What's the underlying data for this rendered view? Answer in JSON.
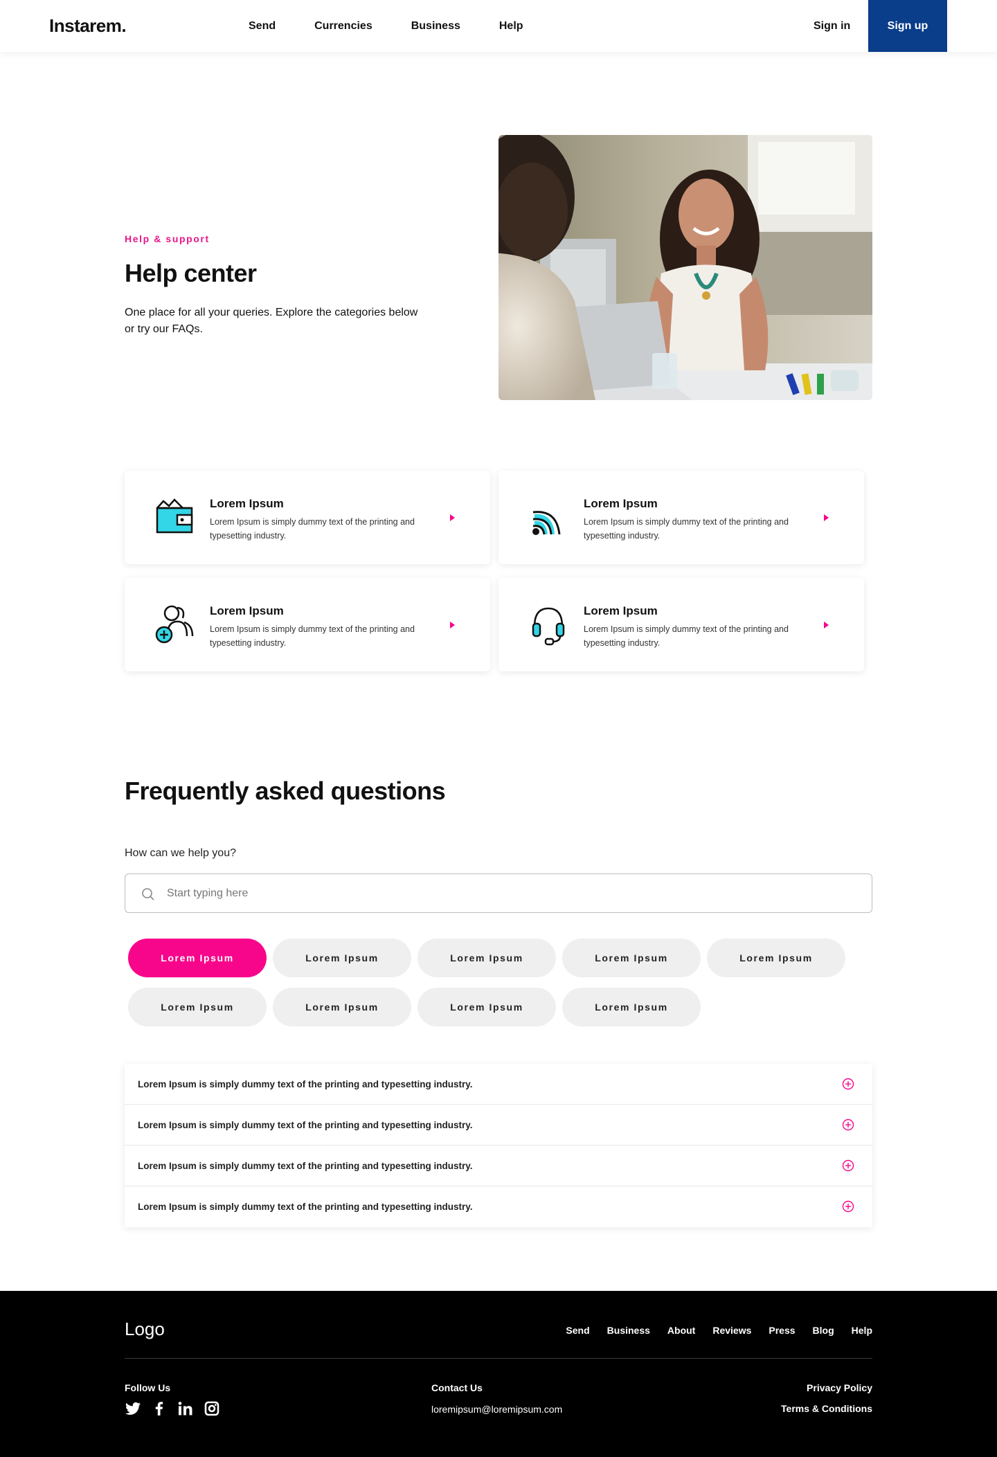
{
  "header": {
    "brand": "Instarem.",
    "nav": [
      "Send",
      "Currencies",
      "Business",
      "Help"
    ],
    "signin_label": "Sign in",
    "signup_label": "Sign up"
  },
  "hero": {
    "eyebrow": "Help & support",
    "title": "Help center",
    "description": "One place for all your queries. Explore the categories below or try our FAQs."
  },
  "categories": [
    {
      "icon": "wallet-icon",
      "title": "Lorem Ipsum",
      "text": "Lorem Ipsum is simply dummy text of the printing and typesetting industry."
    },
    {
      "icon": "signal-icon",
      "title": "Lorem Ipsum",
      "text": "Lorem Ipsum is simply dummy text of the printing and typesetting industry."
    },
    {
      "icon": "users-add-icon",
      "title": "Lorem Ipsum",
      "text": "Lorem Ipsum is simply dummy text of the printing and typesetting industry."
    },
    {
      "icon": "headset-icon",
      "title": "Lorem Ipsum",
      "text": "Lorem Ipsum is simply dummy text of the printing and typesetting industry."
    }
  ],
  "faq": {
    "title": "Frequently asked questions",
    "search_label": "How can we help you?",
    "search_placeholder": "Start typing here",
    "filters": [
      "Lorem Ipsum",
      "Lorem Ipsum",
      "Lorem Ipsum",
      "Lorem Ipsum",
      "Lorem Ipsum",
      "Lorem Ipsum",
      "Lorem Ipsum",
      "Lorem Ipsum",
      "Lorem Ipsum"
    ],
    "active_filter": 0,
    "questions": [
      "Lorem Ipsum is simply dummy text of the printing and typesetting industry.",
      "Lorem Ipsum is simply dummy text of the printing and typesetting industry.",
      "Lorem Ipsum is simply dummy text of the printing and typesetting industry.",
      "Lorem Ipsum is simply dummy text of the printing and typesetting industry."
    ]
  },
  "footer": {
    "logo": "Logo",
    "nav": [
      "Send",
      "Business",
      "About",
      "Reviews",
      "Press",
      "Blog",
      "Help"
    ],
    "follow_label": "Follow Us",
    "social": [
      "twitter-icon",
      "facebook-icon",
      "linkedin-icon",
      "instagram-icon"
    ],
    "contact_label": "Contact Us",
    "email": "loremipsum@loremipsum.com",
    "privacy": "Privacy Policy",
    "terms": "Terms & Conditions"
  },
  "colors": {
    "accent": "#f7068b",
    "brand_blue": "#0a3d8a",
    "icon_cyan": "#32d6e6"
  }
}
